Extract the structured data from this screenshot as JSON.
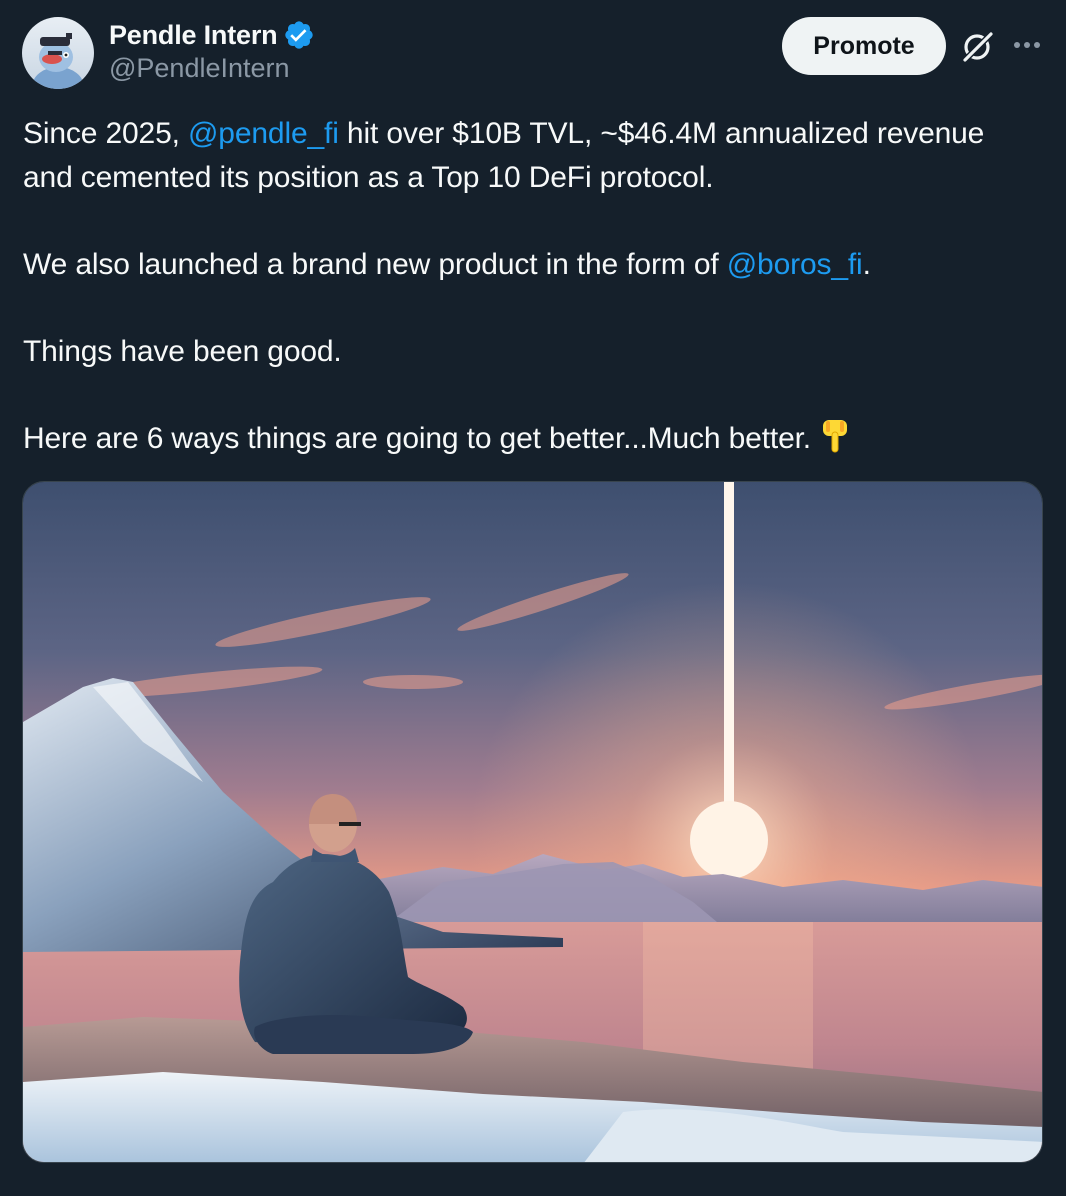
{
  "author": {
    "display_name": "Pendle Intern",
    "handle": "@PendleIntern",
    "verified": true
  },
  "actions": {
    "promote_label": "Promote"
  },
  "icons": {
    "avatar": "pendle-intern-avatar",
    "verified": "verified-badge-icon",
    "grok": "grok-icon",
    "more": "more-horizontal-icon",
    "emoji": "backhand-index-pointing-down-emoji"
  },
  "tweet": {
    "line1": {
      "before": "Since 2025, ",
      "mention": "@pendle_fi",
      "after": " hit over $10B TVL, ~$46.4M annualized revenue"
    },
    "line2": "and cemented its position as a Top 10 DeFi protocol.",
    "line3": {
      "before": "We also launched a brand new product in the form of ",
      "mention": "@boros_fi",
      "after": "."
    },
    "line4": "Things have been good.",
    "line5": "Here are 6 ways things are going to get better...Much better."
  },
  "media": {
    "type": "image",
    "subject": "monk-meditating-at-sunset-lake"
  },
  "colors": {
    "background": "#15202b",
    "text": "#f7f9f9",
    "secondary_text": "#8b98a5",
    "link": "#1d9bf0",
    "verified": "#1d9bf0",
    "button_bg": "#eff3f4"
  }
}
